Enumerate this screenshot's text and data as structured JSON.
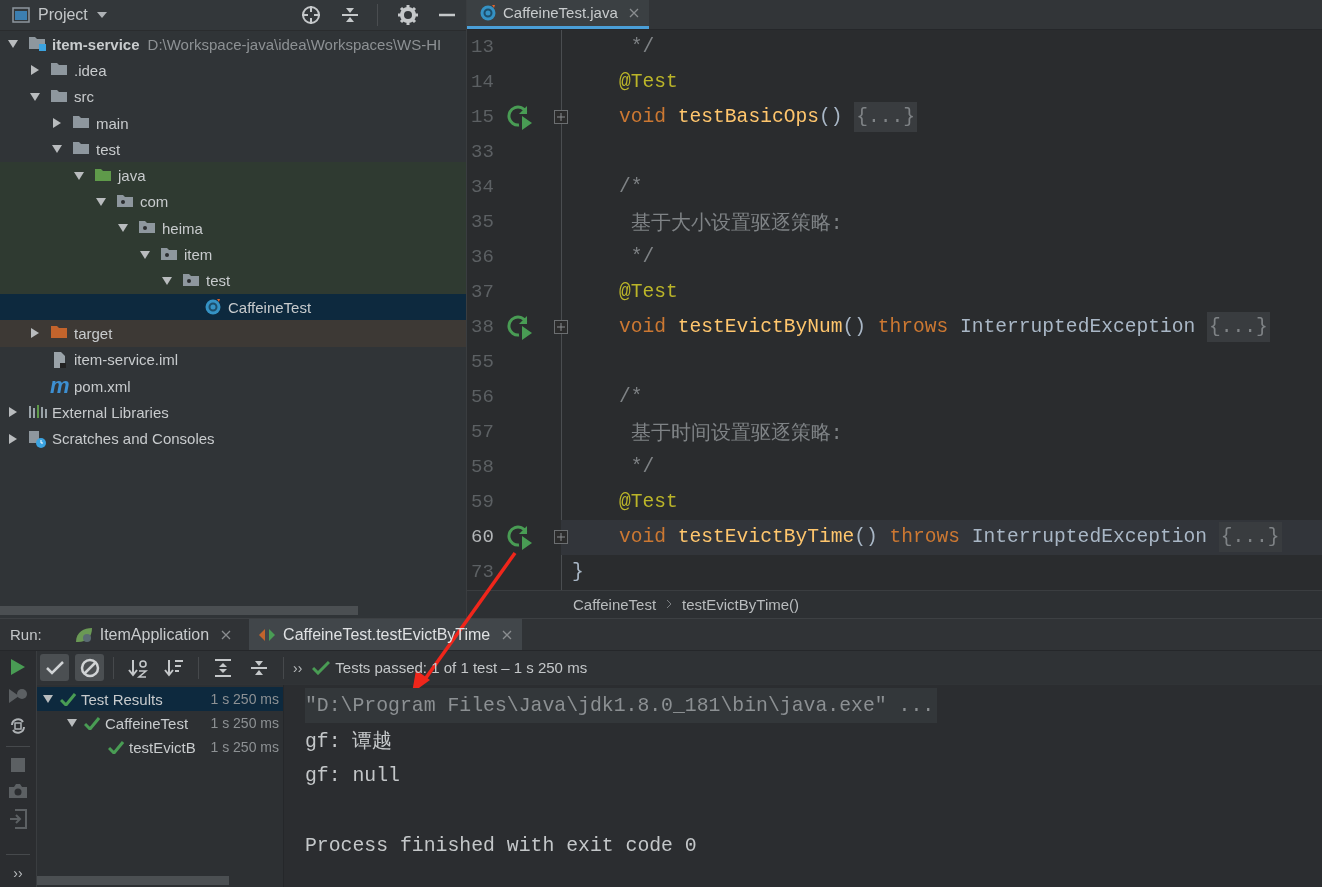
{
  "project_panel": {
    "title": "Project",
    "tree": [
      {
        "label": "item-service",
        "path": "D:\\Workspace-java\\idea\\Workspaces\\WS-HI",
        "kind": "module",
        "expanded": true,
        "selected": false,
        "children": [
          {
            "label": ".idea",
            "kind": "folder",
            "expanded": false,
            "selected": false
          },
          {
            "label": "src",
            "kind": "folder",
            "expanded": true,
            "selected": false,
            "children": [
              {
                "label": "main",
                "kind": "folder",
                "expanded": false,
                "selected": false
              },
              {
                "label": "test",
                "kind": "folder",
                "expanded": true,
                "selected": false,
                "children": [
                  {
                    "label": "java",
                    "kind": "source-folder",
                    "expanded": true,
                    "selected": false,
                    "children": [
                      {
                        "label": "com",
                        "kind": "package",
                        "expanded": true,
                        "selected": false,
                        "children": [
                          {
                            "label": "heima",
                            "kind": "package",
                            "expanded": true,
                            "selected": false,
                            "children": [
                              {
                                "label": "item",
                                "kind": "package",
                                "expanded": true,
                                "selected": false,
                                "children": [
                                  {
                                    "label": "test",
                                    "kind": "package",
                                    "expanded": true,
                                    "selected": false,
                                    "children": [
                                      {
                                        "label": "CaffeineTest",
                                        "kind": "class",
                                        "selected": true
                                      }
                                    ]
                                  }
                                ]
                              }
                            ]
                          }
                        ]
                      }
                    ]
                  }
                ]
              }
            ]
          },
          {
            "label": "target",
            "kind": "excluded-folder",
            "expanded": false,
            "selected": false
          },
          {
            "label": "item-service.iml",
            "kind": "iml-file",
            "selected": false
          },
          {
            "label": "pom.xml",
            "kind": "maven-file",
            "glyph": "m",
            "selected": false
          }
        ]
      },
      {
        "label": "External Libraries",
        "kind": "libraries",
        "expanded": false,
        "selected": false
      },
      {
        "label": "Scratches and Consoles",
        "kind": "scratches",
        "expanded": false,
        "selected": false
      }
    ]
  },
  "editor": {
    "tabs": [
      {
        "label": "CaffeineTest.java",
        "selected": true
      }
    ],
    "lines": [
      {
        "number": "13",
        "tokens": [
          {
            "kind": "comment",
            "text": "     */"
          }
        ]
      },
      {
        "number": "14",
        "tokens": [
          {
            "kind": "annotation",
            "text": "    @Test"
          }
        ]
      },
      {
        "number": "15",
        "run": true,
        "folded": true,
        "tokens": [
          {
            "kind": "keyword",
            "text": "    void "
          },
          {
            "kind": "method",
            "text": "testBasicOps"
          },
          {
            "kind": "plain",
            "text": "() "
          },
          {
            "kind": "fold",
            "text": "{...}"
          }
        ]
      },
      {
        "number": "33"
      },
      {
        "number": "34",
        "tokens": [
          {
            "kind": "comment",
            "text": "    /*"
          }
        ]
      },
      {
        "number": "35",
        "tokens": [
          {
            "kind": "comment",
            "text": "     基于大小设置驱逐策略:"
          }
        ]
      },
      {
        "number": "36",
        "tokens": [
          {
            "kind": "comment",
            "text": "     */"
          }
        ]
      },
      {
        "number": "37",
        "tokens": [
          {
            "kind": "annotation",
            "text": "    @Test"
          }
        ]
      },
      {
        "number": "38",
        "run": true,
        "folded": true,
        "tokens": [
          {
            "kind": "keyword",
            "text": "    void "
          },
          {
            "kind": "method",
            "text": "testEvictByNum"
          },
          {
            "kind": "plain",
            "text": "() "
          },
          {
            "kind": "keyword",
            "text": "throws "
          },
          {
            "kind": "plain",
            "text": "InterruptedException "
          },
          {
            "kind": "fold",
            "text": "{...}"
          }
        ]
      },
      {
        "number": "55"
      },
      {
        "number": "56",
        "tokens": [
          {
            "kind": "comment",
            "text": "    /*"
          }
        ]
      },
      {
        "number": "57",
        "tokens": [
          {
            "kind": "comment",
            "text": "     基于时间设置驱逐策略:"
          }
        ]
      },
      {
        "number": "58",
        "tokens": [
          {
            "kind": "comment",
            "text": "     */"
          }
        ]
      },
      {
        "number": "59",
        "tokens": [
          {
            "kind": "annotation",
            "text": "    @Test"
          }
        ]
      },
      {
        "number": "60",
        "run": true,
        "folded": true,
        "current": true,
        "tokens": [
          {
            "kind": "keyword",
            "text": "    void "
          },
          {
            "kind": "method",
            "text": "testEvictByTime"
          },
          {
            "kind": "plain",
            "text": "() "
          },
          {
            "kind": "keyword",
            "text": "throws "
          },
          {
            "kind": "plain",
            "text": "InterruptedException "
          },
          {
            "kind": "fold",
            "text": "{...}"
          }
        ]
      },
      {
        "number": "73",
        "tokens": [
          {
            "kind": "plain",
            "text": "}"
          }
        ]
      }
    ],
    "breadcrumbs": [
      "CaffeineTest",
      "testEvictByTime()"
    ]
  },
  "run_panel": {
    "label": "Run:",
    "tabs": [
      {
        "label": "ItemApplication",
        "kind": "app",
        "selected": false
      },
      {
        "label": "CaffeineTest.testEvictByTime",
        "kind": "test",
        "selected": true
      }
    ],
    "filters": [
      {
        "kind": "passed",
        "on": true
      },
      {
        "kind": "ignored",
        "on": true
      }
    ],
    "more": "››",
    "side_more": "››",
    "status": {
      "passed": true,
      "text": "Tests passed: 1 of 1 test – 1 s 250 ms"
    },
    "results": [
      {
        "label": "Test Results",
        "time": "1 s 250 ms",
        "passed": true,
        "expanded": true,
        "selected": true,
        "children": [
          {
            "label": "CaffeineTest",
            "time": "1 s 250 ms",
            "passed": true,
            "expanded": true,
            "selected": false,
            "children": [
              {
                "label": "testEvictB",
                "time": "1 s 250 ms",
                "passed": true,
                "selected": false
              }
            ]
          }
        ]
      }
    ],
    "console": [
      {
        "kind": "command",
        "text": "\"D:\\Program Files\\Java\\jdk1.8.0_181\\bin\\java.exe\" ..."
      },
      {
        "kind": "output",
        "text": "gf: 谭越"
      },
      {
        "kind": "output",
        "text": "gf: null"
      },
      {
        "kind": "exit",
        "text": "Process finished with exit code 0"
      }
    ]
  }
}
